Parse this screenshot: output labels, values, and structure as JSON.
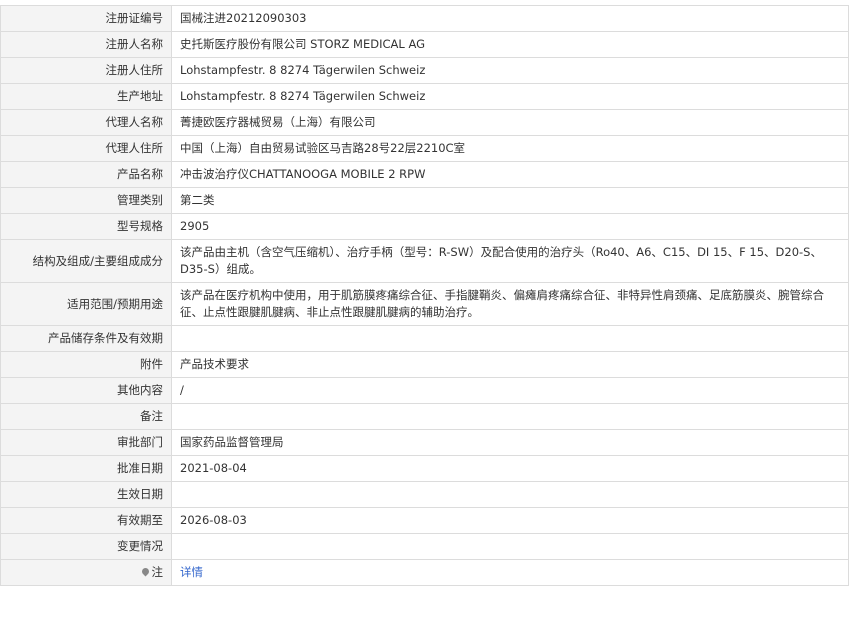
{
  "rows": [
    {
      "label": "注册证编号",
      "value": "国械注进20212090303"
    },
    {
      "label": "注册人名称",
      "value": "史托斯医疗股份有限公司 STORZ MEDICAL AG"
    },
    {
      "label": "注册人住所",
      "value": "Lohstampfestr. 8 8274 Tägerwilen Schweiz"
    },
    {
      "label": "生产地址",
      "value": "Lohstampfestr. 8 8274 Tägerwilen Schweiz"
    },
    {
      "label": "代理人名称",
      "value": "菁捷欧医疗器械贸易（上海）有限公司"
    },
    {
      "label": "代理人住所",
      "value": "中国（上海）自由贸易试验区马吉路28号22层2210C室"
    },
    {
      "label": "产品名称",
      "value": "冲击波治疗仪CHATTANOOGA MOBILE 2 RPW"
    },
    {
      "label": "管理类别",
      "value": "第二类"
    },
    {
      "label": "型号规格",
      "value": "2905"
    },
    {
      "label": "结构及组成/主要组成成分",
      "value": "该产品由主机（含空气压缩机）、治疗手柄（型号：R-SW）及配合使用的治疗头（Ro40、A6、C15、DI 15、F 15、D20-S、D35-S）组成。"
    },
    {
      "label": "适用范围/预期用途",
      "value": "该产品在医疗机构中使用，用于肌筋膜疼痛综合征、手指腱鞘炎、偏瘫肩疼痛综合征、非特异性肩颈痛、足底筋膜炎、腕管综合征、止点性跟腱肌腱病、非止点性跟腱肌腱病的辅助治疗。"
    },
    {
      "label": "产品储存条件及有效期",
      "value": ""
    },
    {
      "label": "附件",
      "value": "产品技术要求"
    },
    {
      "label": "其他内容",
      "value": "/"
    },
    {
      "label": "备注",
      "value": ""
    },
    {
      "label": "审批部门",
      "value": "国家药品监督管理局"
    },
    {
      "label": "批准日期",
      "value": "2021-08-04"
    },
    {
      "label": "生效日期",
      "value": ""
    },
    {
      "label": "有效期至",
      "value": "2026-08-03"
    },
    {
      "label": "变更情况",
      "value": ""
    }
  ],
  "note": {
    "label": "注",
    "link_text": "详情",
    "icon": "location-pin-icon"
  }
}
